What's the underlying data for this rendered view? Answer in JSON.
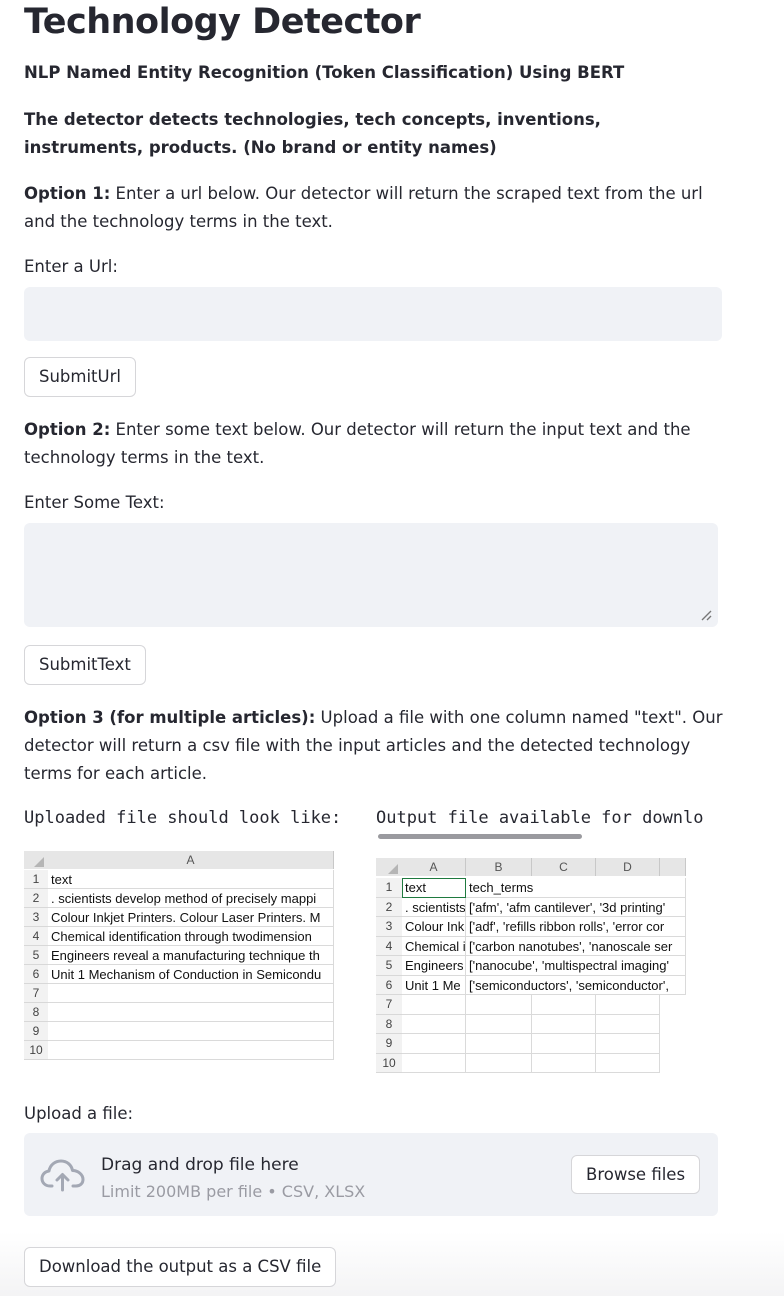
{
  "header": {
    "title": "Technology Detector",
    "subtitle": "NLP Named Entity Recognition (Token Classification) Using BERT",
    "description": "The detector detects technologies, tech concepts, inventions, instruments, products. (No brand or entity names)"
  },
  "option1": {
    "label": "Option 1:",
    "text": " Enter a url below. Our detector will return the scraped text from the url and the technology terms in the text.",
    "input_label": "Enter a Url:",
    "input_value": "",
    "button": "SubmitUrl"
  },
  "option2": {
    "label": "Option 2:",
    "text": " Enter some text below. Our detector will return the input text and the technology terms in the text.",
    "input_label": "Enter Some Text:",
    "input_value": "",
    "button": "SubmitText"
  },
  "option3": {
    "label": "Option 3 (for multiple articles):",
    "text": " Upload a file with one column named \"text\". Our detector will return a csv file with the input articles and the detected technology terms for each article."
  },
  "tabs": {
    "uploaded": "Uploaded file should look like:",
    "output": "Output file available for downlo"
  },
  "sheet1": {
    "columns": [
      "A"
    ],
    "rows": [
      "1",
      "2",
      "3",
      "4",
      "5",
      "6",
      "7",
      "8",
      "9",
      "10"
    ],
    "cells": [
      "text",
      ". scientists develop method of precisely mappi",
      "Colour Inkjet Printers. Colour Laser Printers. M",
      "Chemical identification through twodimension",
      "Engineers reveal a manufacturing technique th",
      "Unit 1 Mechanism of Conduction in Semicondu",
      "",
      "",
      "",
      ""
    ]
  },
  "sheet2": {
    "columns": [
      "A",
      "B",
      "C",
      "D"
    ],
    "rows": [
      "1",
      "2",
      "3",
      "4",
      "5",
      "6",
      "7",
      "8",
      "9",
      "10"
    ],
    "col_a": [
      "text",
      ". scientists",
      "Colour Ink",
      "Chemical i",
      "Engineers",
      "Unit 1 Me",
      "",
      "",
      "",
      ""
    ],
    "col_b": [
      "tech_terms",
      "['afm', 'afm cantilever', '3d printing'",
      "['adf', 'refills ribbon rolls', 'error cor",
      "['carbon nanotubes', 'nanoscale ser",
      "['nanocube', 'multispectral imaging'",
      "['semiconductors', 'semiconductor',",
      "",
      "",
      "",
      ""
    ]
  },
  "upload": {
    "label": "Upload a file:",
    "drag_text": "Drag and drop file here",
    "limit_text": "Limit 200MB per file • CSV, XLSX",
    "browse_button": "Browse files",
    "icon": "cloud-upload-icon"
  },
  "download": {
    "button": "Download the output as a CSV file"
  }
}
